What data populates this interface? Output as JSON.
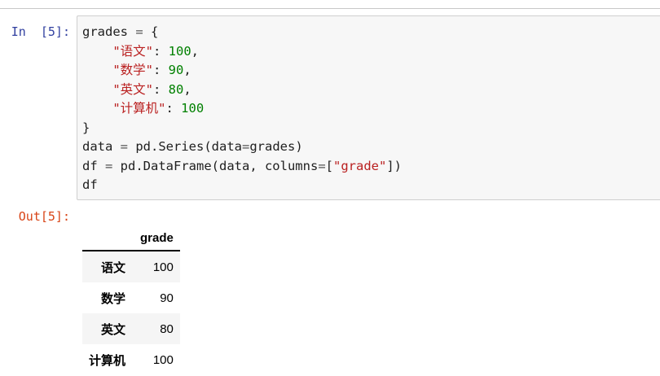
{
  "cell": {
    "in_prompt": "In  [5]:",
    "out_prompt": "Out[5]:",
    "code_lines": [
      "grades = {",
      "    \"语文\": 100,",
      "    \"数学\": 90,",
      "    \"英文\": 80,",
      "    \"计算机\": 100",
      "}",
      "data = pd.Series(data=grades)",
      "df = pd.DataFrame(data, columns=[\"grade\"])",
      "df"
    ]
  },
  "dataframe": {
    "index_header": "",
    "column_header": "grade",
    "rows": [
      {
        "index": "语文",
        "grade": "100"
      },
      {
        "index": "数学",
        "grade": "90"
      },
      {
        "index": "英文",
        "grade": "80"
      },
      {
        "index": "计算机",
        "grade": "100"
      }
    ]
  },
  "colors": {
    "in_prompt": "#303f9f",
    "out_prompt": "#d84315",
    "string": "#ba2121",
    "number": "#008000",
    "cell_background": "#f7f7f7"
  }
}
